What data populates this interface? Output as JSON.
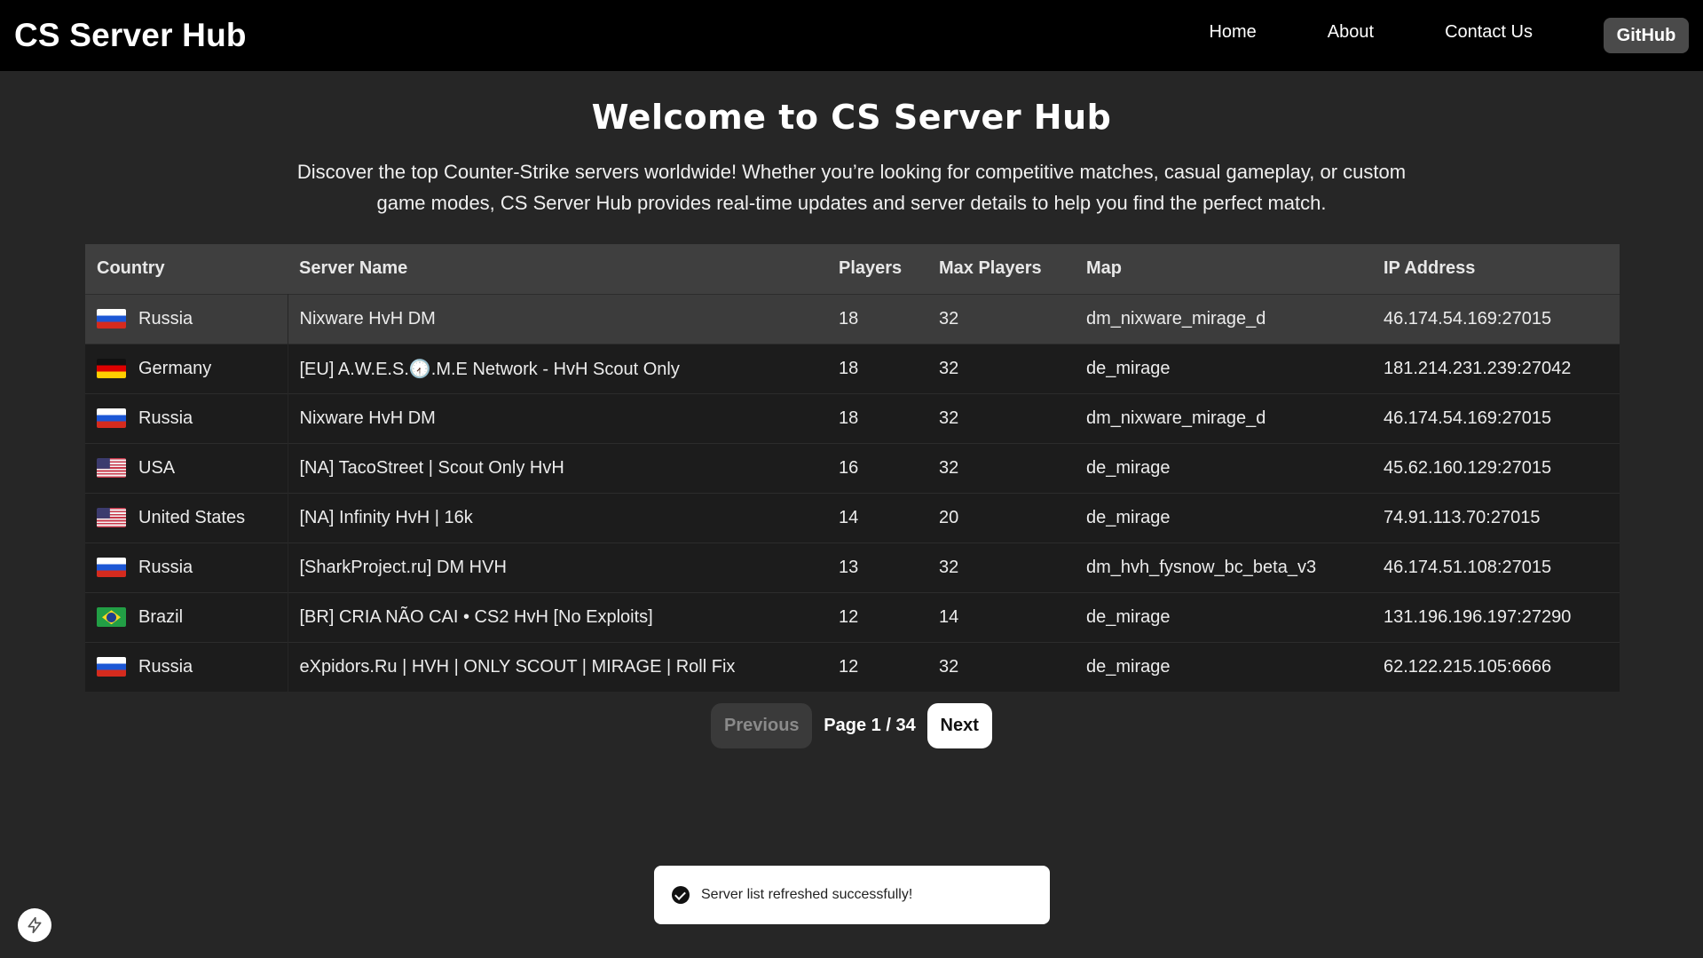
{
  "navbar": {
    "brand": "CS Server Hub",
    "links": [
      "Home",
      "About",
      "Contact Us"
    ],
    "github_label": "GitHub"
  },
  "hero": {
    "title": "Welcome to CS Server Hub",
    "description": "Discover the top Counter-Strike servers worldwide! Whether you’re looking for competitive matches, casual gameplay, or custom game modes, CS Server Hub provides real-time updates and server details to help you find the perfect match."
  },
  "table": {
    "columns": [
      "Country",
      "Server Name",
      "Players",
      "Max Players",
      "Map",
      "IP Address"
    ],
    "rows": [
      {
        "flag": "russia-flag",
        "country": "Russia",
        "name": "Nixware HvH DM",
        "players": "18",
        "max": "32",
        "map": "dm_nixware_mirage_d",
        "ip": "46.174.54.169:27015"
      },
      {
        "flag": "germany-flag",
        "country": "Germany",
        "name": "[EU] A.W.E.S.🕢.M.E Network - HvH Scout Only",
        "players": "18",
        "max": "32",
        "map": "de_mirage",
        "ip": "181.214.231.239:27042"
      },
      {
        "flag": "russia-flag",
        "country": "Russia",
        "name": "Nixware HvH DM",
        "players": "18",
        "max": "32",
        "map": "dm_nixware_mirage_d",
        "ip": "46.174.54.169:27015"
      },
      {
        "flag": "usa-flag",
        "country": "USA",
        "name": "[NA] TacoStreet | Scout Only HvH",
        "players": "16",
        "max": "32",
        "map": "de_mirage",
        "ip": "45.62.160.129:27015"
      },
      {
        "flag": "usa-flag",
        "country": "United States",
        "name": "[NA] Infinity HvH | 16k",
        "players": "14",
        "max": "20",
        "map": "de_mirage",
        "ip": "74.91.113.70:27015"
      },
      {
        "flag": "russia-flag",
        "country": "Russia",
        "name": "[SharkProject.ru] DM HVH",
        "players": "13",
        "max": "32",
        "map": "dm_hvh_fysnow_bc_beta_v3",
        "ip": "46.174.51.108:27015"
      },
      {
        "flag": "brazil-flag",
        "country": "Brazil",
        "name": "[BR] CRIA NÃO CAI • CS2 HvH [No Exploits]",
        "players": "12",
        "max": "14",
        "map": "de_mirage",
        "ip": "131.196.196.197:27290"
      },
      {
        "flag": "russia-flag",
        "country": "Russia",
        "name": "eXpidors.Ru | HVH | ONLY SCOUT | MIRAGE | Roll Fix",
        "players": "12",
        "max": "32",
        "map": "de_mirage",
        "ip": "62.122.215.105:6666"
      }
    ]
  },
  "pagination": {
    "previous_label": "Previous",
    "page_label": "Page 1 / 34",
    "next_label": "Next"
  },
  "toast": {
    "icon": "check-circle-icon",
    "message": "Server list refreshed successfully!"
  },
  "corner_button": {
    "icon": "lightning-bolt-icon"
  }
}
